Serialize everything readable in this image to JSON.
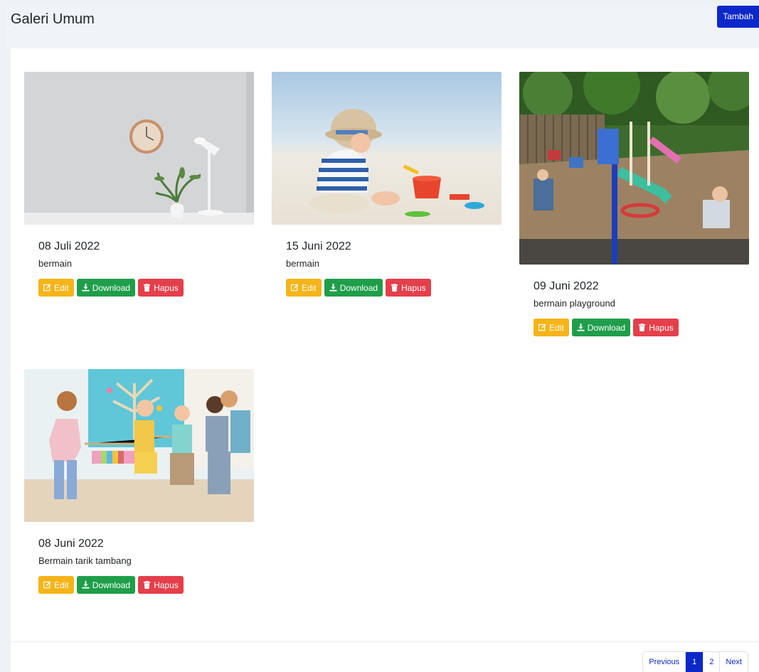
{
  "header": {
    "title": "Galeri Umum",
    "add_label": "Tambah"
  },
  "buttons": {
    "edit": "Edit",
    "download": "Download",
    "delete": "Hapus"
  },
  "cards": [
    {
      "date": "08 Juli 2022",
      "desc": "bermain",
      "image": "white wall with wooden clock, lamp and plant"
    },
    {
      "date": "15 Juni 2022",
      "desc": "bermain",
      "image": "toddler with hat playing in sand with red bucket"
    },
    {
      "date": "09 Juni 2022",
      "desc": "bermain playground",
      "image": "children at outdoor playground with slides"
    },
    {
      "date": "08 Juni 2022",
      "desc": "Bermain tarik tambang",
      "image": "children playing tug of war indoors"
    }
  ],
  "pagination": {
    "previous": "Previous",
    "pages": [
      "1",
      "2"
    ],
    "current": "1",
    "next": "Next"
  },
  "colors": {
    "primary": "#0d28c9",
    "warning": "#f5b418",
    "success": "#1f9e4a",
    "danger": "#e43f4a"
  }
}
